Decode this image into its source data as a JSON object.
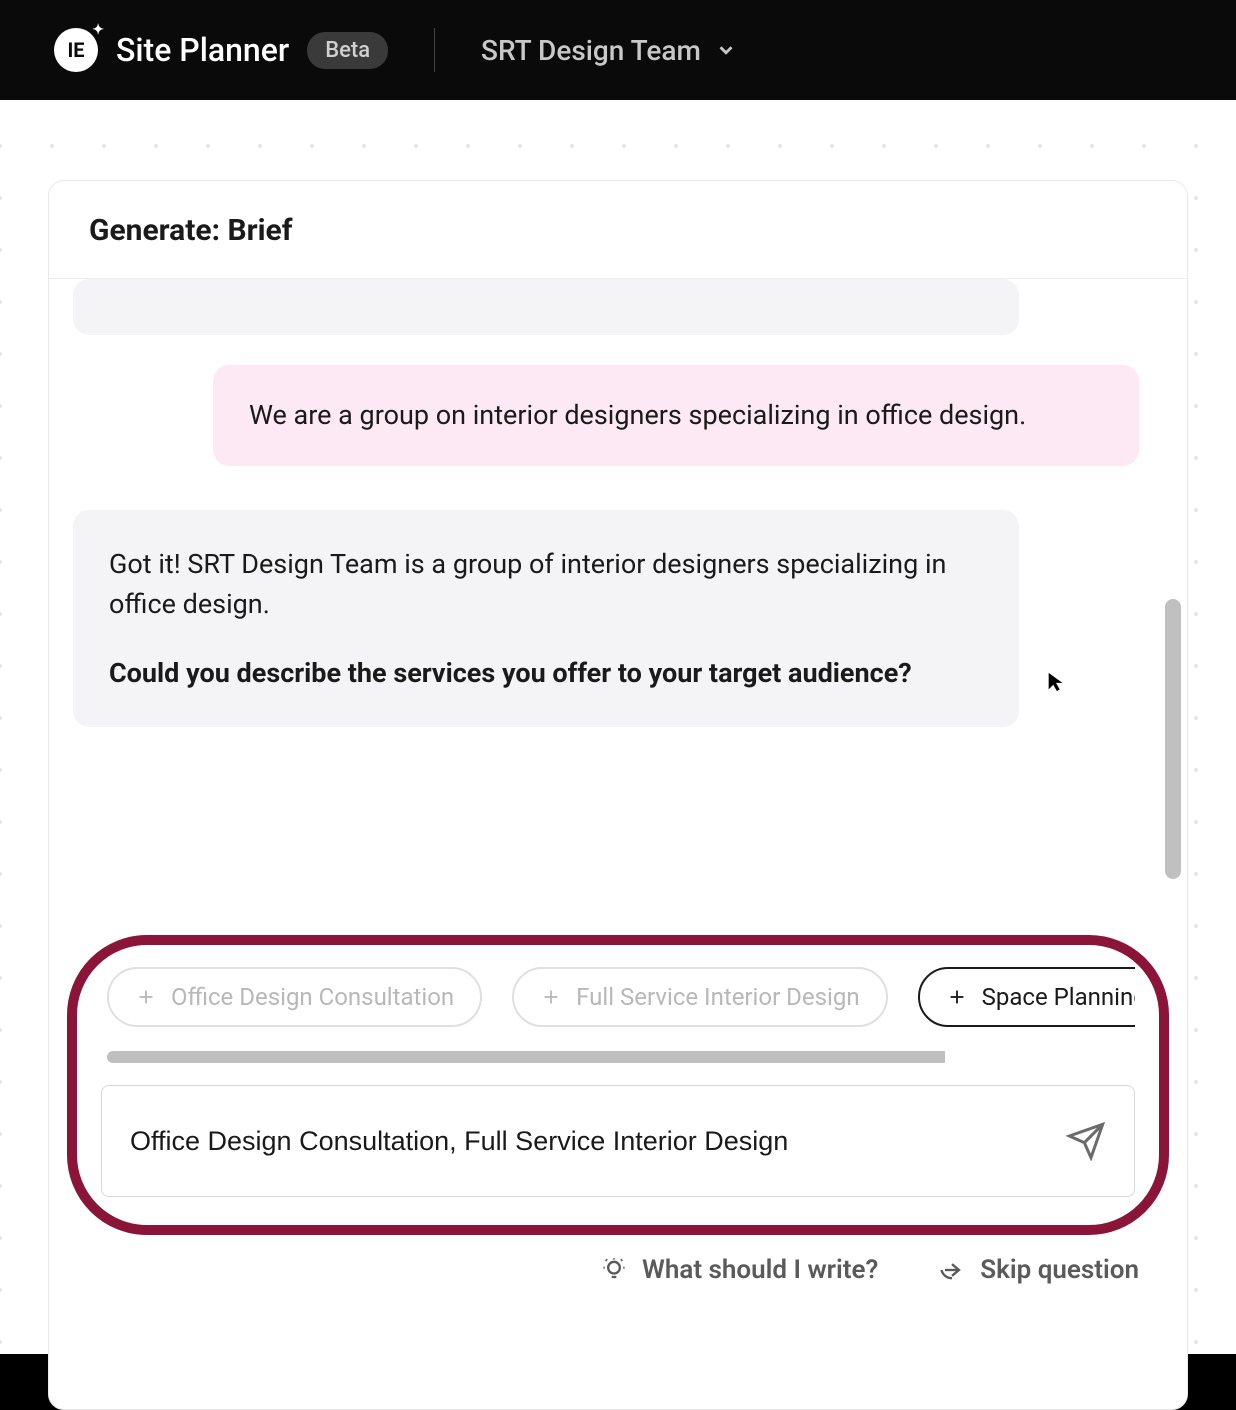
{
  "header": {
    "app_title": "Site Planner",
    "beta_label": "Beta",
    "team_name": "SRT Design Team"
  },
  "card": {
    "title": "Generate: Brief"
  },
  "chat": {
    "user_message": "We are a group on interior designers specializing in office design.",
    "bot_message_line1": "Got it! SRT Design Team is a group of interior designers specializing in office design.",
    "bot_message_line2": "Could you describe the services you offer to your target audience?"
  },
  "suggestions": {
    "chips": [
      {
        "label": "Office Design Consultation",
        "active": false
      },
      {
        "label": "Full Service Interior Design",
        "active": false
      },
      {
        "label": "Space Planning",
        "active": true
      }
    ]
  },
  "input": {
    "value": "Office Design Consultation, Full Service Interior Design"
  },
  "footer": {
    "hint_label": "What should I write?",
    "skip_label": "Skip question"
  }
}
